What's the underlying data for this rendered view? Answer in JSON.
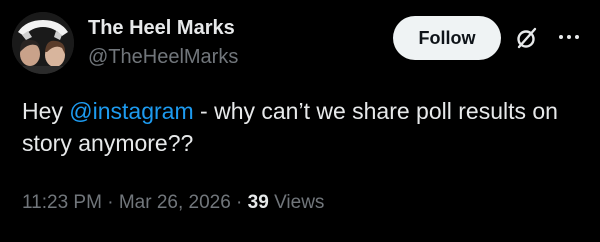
{
  "author": {
    "name": "The Heel Marks",
    "handle": "@TheHeelMarks",
    "avatar_icon": "band-avatar-icon"
  },
  "actions": {
    "follow_label": "Follow",
    "grok_icon": "slashed-circle-icon",
    "more_icon": "more-dots-icon"
  },
  "tweet": {
    "text_before": "Hey ",
    "mention": "@instagram",
    "text_after": " - why can’t we share poll results on story anymore??"
  },
  "meta": {
    "time": "11:23 PM",
    "separator": " · ",
    "date": "Mar 26, 2026",
    "views_count": "39",
    "views_label": " Views"
  },
  "colors": {
    "background": "#000000",
    "primary_text": "#e7e9ea",
    "secondary_text": "#71767b",
    "link": "#1d9bf0",
    "follow_bg": "#eff3f4"
  }
}
